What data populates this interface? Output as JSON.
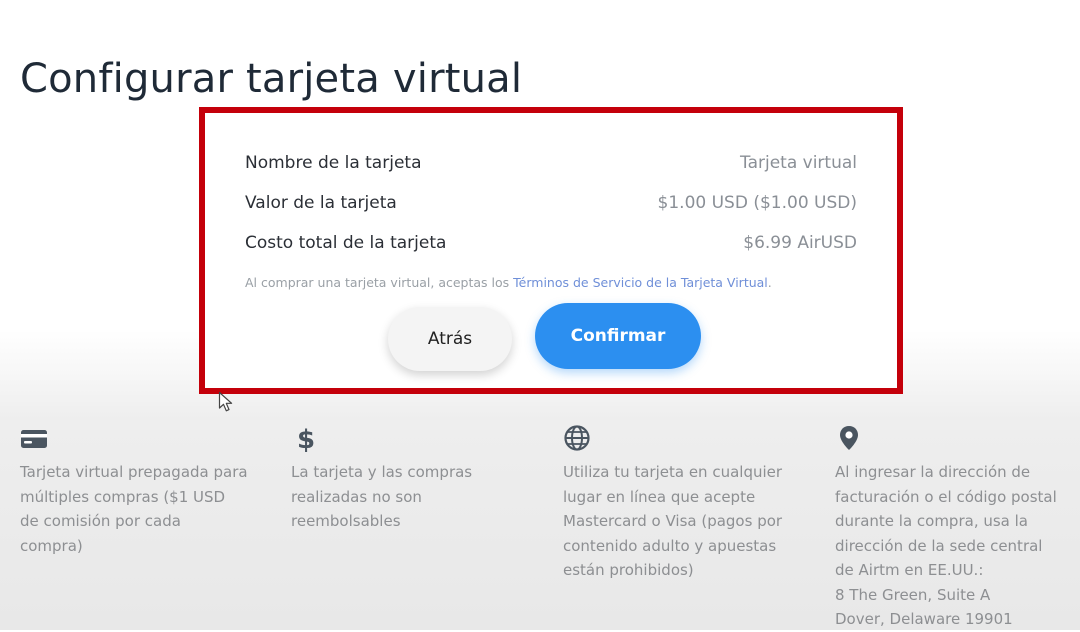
{
  "page": {
    "title": "Configurar tarjeta virtual"
  },
  "summary": {
    "rows": [
      {
        "label": "Nombre de la tarjeta",
        "value": "Tarjeta virtual"
      },
      {
        "label": "Valor de la tarjeta",
        "value": "$1.00 USD ($1.00 USD)"
      },
      {
        "label": "Costo total de la tarjeta",
        "value": "$6.99 AirUSD"
      }
    ],
    "terms_prefix": "Al comprar una tarjeta virtual, aceptas los ",
    "terms_link": "Términos de Servicio de la Tarjeta Virtual",
    "terms_suffix": "."
  },
  "buttons": {
    "back_label": "Atrás",
    "confirm_label": "Confirmar"
  },
  "features": [
    {
      "icon": "credit-card-icon",
      "text": "Tarjeta virtual prepagada para\nmúltiples compras ($1 USD\nde comisión por cada\ncompra)"
    },
    {
      "icon": "dollar-icon",
      "text": "La tarjeta y las compras\nrealizadas no son\nreembolsables"
    },
    {
      "icon": "globe-icon",
      "text": "Utiliza tu tarjeta en cualquier\nlugar en línea que acepte\nMastercard o Visa (pagos por\ncontenido adulto y apuestas\nestán prohibidos)"
    },
    {
      "icon": "location-pin-icon",
      "text": "Al ingresar la dirección de\nfacturación o el código postal\ndurante la compra, usa la\ndirección de la sede central\nde Airtm en EE.UU.:\n8 The Green, Suite A\nDover, Delaware 19901"
    }
  ],
  "colors": {
    "highlight_border": "#c4000a",
    "confirm_button": "#2c8ff0",
    "link": "#6f8fd8"
  }
}
